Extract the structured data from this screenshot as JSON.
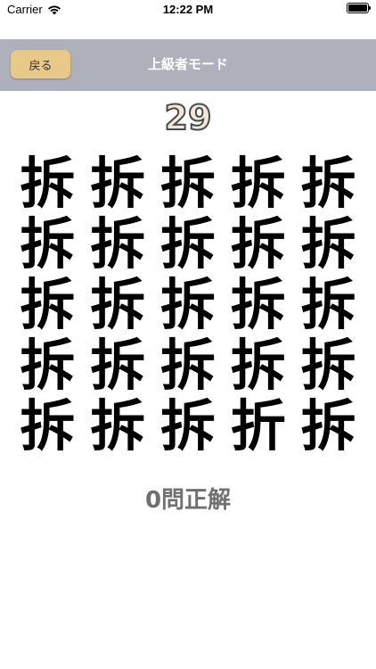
{
  "status": {
    "carrier": "Carrier",
    "time": "12:22 PM"
  },
  "nav": {
    "back_label": "戻る",
    "title": "上級者モード"
  },
  "timer": "29",
  "grid": [
    "拆",
    "拆",
    "拆",
    "拆",
    "拆",
    "拆",
    "拆",
    "拆",
    "拆",
    "拆",
    "拆",
    "拆",
    "拆",
    "拆",
    "拆",
    "拆",
    "拆",
    "拆",
    "拆",
    "拆",
    "拆",
    "拆",
    "拆",
    "折",
    "拆"
  ],
  "score": "0問正解",
  "colors": {
    "nav_bg": "#aeb0bb",
    "back_button": "#e8c98a",
    "timer_fill": "#f1e8d8"
  }
}
